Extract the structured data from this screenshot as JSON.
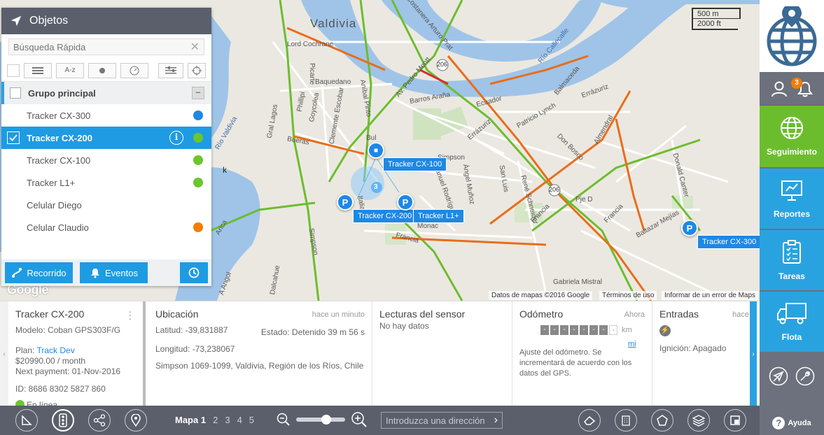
{
  "map": {
    "scale": {
      "metric": "500 m",
      "imperial": "2000 ft"
    },
    "attribution": {
      "data": "Datos de mapas ©2016 Google",
      "terms": "Términos de uso",
      "report": "Informar de un error de Maps"
    },
    "google_logo": "Google",
    "labels": {
      "city": "Valdivia",
      "rio_valdivia": "Río Valdivia",
      "rio_callecalle": "Río Callecalle",
      "lord_cochrane": "Lord Cochrane",
      "baquedano": "Baquedano",
      "picarte": "Picarte",
      "gral_lagos": "Gral Lagos",
      "phillipi": "Phillipi",
      "goycolea": "Goycolea",
      "clemente_escobar": "Clemente Escobar",
      "bueras": "Bueras",
      "costanera": "Costanera Arturo Prat",
      "av_pedro_montt": "Av. Pedro Montt",
      "anibal_pinto": "Aníbal Pinto",
      "barros_arana": "Barros Araña",
      "ecuador": "Ecuador",
      "balmaceda": "Balmaceda",
      "patricio_lynch": "Patricio Lynch",
      "errazuriz": "Errázuriz",
      "errazuriz2": "Errázuriz",
      "almendral": "Almendral",
      "don_bosco": "Don Bosco",
      "simpson": "Simpson",
      "simpson2": "Simpson",
      "angel_munoz": "Ángel Muñoz",
      "san_luis": "San Luis",
      "rene_schneider": "René Schneider",
      "manuel_rodriguez": "Manuel Rodríguez",
      "italia": "Italia",
      "francia": "Francia",
      "francia2": "Francia",
      "francia3": "Francia",
      "bulnes": "Bul",
      "pje_d": "Pje D",
      "donald_canter": "Donald Canter",
      "baltazar": "Baltazar Mejías",
      "monac": "Monac",
      "dalcahue": "Dalcahue",
      "gabriela": "Gabriela Mistral",
      "anco": "A Angol",
      "route206a": "206",
      "route206b": "206",
      "arica": "Arica",
      "k": "k"
    },
    "markers": [
      {
        "id": "cx100",
        "symbol": "■",
        "label": "Tracker CX-100",
        "color": "#1e88e5"
      },
      {
        "id": "cx200",
        "symbol": "P",
        "label": "Tracker CX-200",
        "color": "#1e88e5"
      },
      {
        "id": "l1",
        "symbol": "P",
        "label": "Tracker L1+",
        "color": "#1e88e5"
      },
      {
        "id": "cx300",
        "symbol": "P",
        "label": "Tracker CX-300",
        "color": "#1e88e5"
      }
    ],
    "cluster_count": "3"
  },
  "objects_panel": {
    "title": "Objetos",
    "search_placeholder": "Búsqueda Rápida",
    "toolbar": {
      "sort_label": "A-z"
    },
    "group_label": "Grupo principal",
    "items": [
      {
        "name": "Tracker CX-300",
        "status_color": "#1e88e5",
        "selected": false
      },
      {
        "name": "Tracker CX-200",
        "status_color": "#6cc62d",
        "selected": true
      },
      {
        "name": "Tracker CX-100",
        "status_color": "#6cc62d",
        "selected": false
      },
      {
        "name": "Tracker L1+",
        "status_color": "#6cc62d",
        "selected": false
      },
      {
        "name": "Celular Diego",
        "status_color": "",
        "selected": false
      },
      {
        "name": "Celular Claudio",
        "status_color": "#f57c00",
        "selected": false
      }
    ],
    "footer": {
      "route_label": "Recorrido",
      "events_label": "Eventos"
    }
  },
  "sidebar": {
    "notifications_count": "3",
    "nav": [
      {
        "label": "Seguimiento",
        "icon": "globe-icon"
      },
      {
        "label": "Reportes",
        "icon": "chart-board-icon"
      },
      {
        "label": "Tareas",
        "icon": "clipboard-icon"
      },
      {
        "label": "Flota",
        "icon": "truck-icon"
      }
    ],
    "help_label": "Ayuda",
    "help_icon": "?"
  },
  "info": {
    "device": {
      "title": "Tracker CX-200",
      "model": "Modelo: Coban GPS303F/G",
      "plan_prefix": "Plan: ",
      "plan_link": "Track Dev",
      "price": "$20990.00 / month",
      "next_payment": "Next payment: 01-Nov-2016",
      "id": "ID: 8686 8302 5827 860",
      "status": "En línea",
      "status_color": "#6cc62d"
    },
    "location": {
      "title": "Ubicación",
      "ago": "hace un minuto",
      "lat": "Latitud: -39,831887",
      "state": "Estado: Detenido 39 m 56 s",
      "lon": "Longitud: -73,238067",
      "address": "Simpson 1069-1099, Valdivia, Región de los Ríos, Chile"
    },
    "sensors": {
      "title": "Lecturas del sensor",
      "value": "No hay datos"
    },
    "odometer": {
      "title": "Odómetro",
      "ago": "Ahora",
      "digits": [
        "-",
        "-",
        "-",
        "-",
        "-",
        "-",
        "-"
      ],
      "last_digit": "-",
      "unit_km": "km",
      "unit_mi": "mi",
      "note": "Ajuste del odómetro. Se incrementará de acuerdo con los datos del GPS."
    },
    "inputs": {
      "title": "Entradas",
      "ago": "hace",
      "ignition": "Ignición: Apagado"
    }
  },
  "bottombar": {
    "maps_label": "Mapa",
    "maps": [
      "1",
      "2",
      "3",
      "4",
      "5"
    ],
    "address_placeholder": "Introduzca una dirección"
  }
}
